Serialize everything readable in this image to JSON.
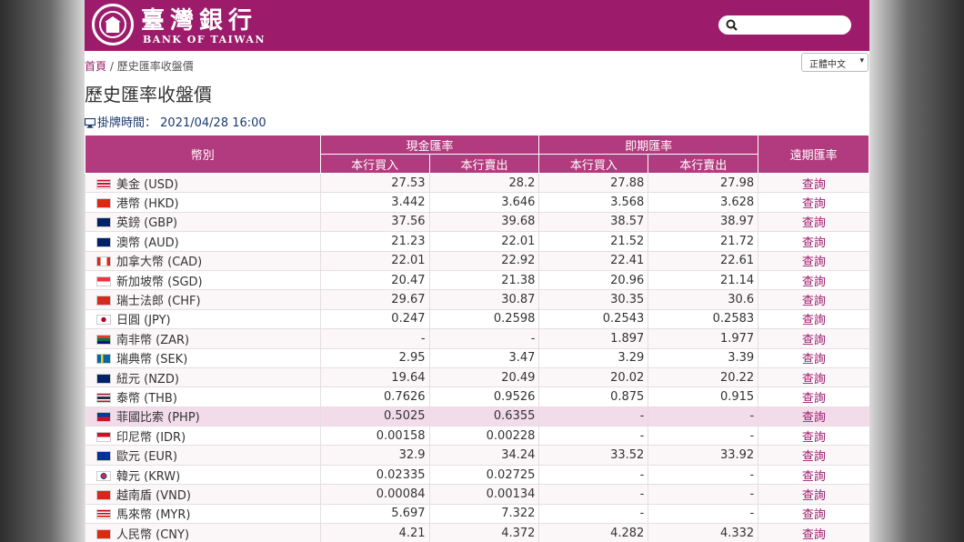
{
  "header": {
    "logo_cn": "臺灣銀行",
    "logo_en": "BANK OF TAIWAN"
  },
  "breadcrumb": {
    "home": "首頁",
    "separator": " / ",
    "current": "歷史匯率收盤價"
  },
  "language": {
    "selected": "正體中文"
  },
  "page_title": "歷史匯率收盤價",
  "quote_time": {
    "label": "掛牌時間：",
    "value": "2021/04/28 16:00"
  },
  "table": {
    "headers": {
      "currency": "幣別",
      "cash": "現金匯率",
      "spot": "即期匯率",
      "forward": "遠期匯率",
      "buy": "本行買入",
      "sell": "本行賣出"
    },
    "rows": [
      {
        "flag": "us",
        "name": "美金 (USD)",
        "cash_buy": "27.53",
        "cash_sell": "28.2",
        "spot_buy": "27.88",
        "spot_sell": "27.98",
        "query": "查詢"
      },
      {
        "flag": "hk",
        "name": "港幣 (HKD)",
        "cash_buy": "3.442",
        "cash_sell": "3.646",
        "spot_buy": "3.568",
        "spot_sell": "3.628",
        "query": "查詢"
      },
      {
        "flag": "gb",
        "name": "英鎊 (GBP)",
        "cash_buy": "37.56",
        "cash_sell": "39.68",
        "spot_buy": "38.57",
        "spot_sell": "38.97",
        "query": "查詢"
      },
      {
        "flag": "au",
        "name": "澳幣 (AUD)",
        "cash_buy": "21.23",
        "cash_sell": "22.01",
        "spot_buy": "21.52",
        "spot_sell": "21.72",
        "query": "查詢"
      },
      {
        "flag": "ca",
        "name": "加拿大幣 (CAD)",
        "cash_buy": "22.01",
        "cash_sell": "22.92",
        "spot_buy": "22.41",
        "spot_sell": "22.61",
        "query": "查詢"
      },
      {
        "flag": "sg",
        "name": "新加坡幣 (SGD)",
        "cash_buy": "20.47",
        "cash_sell": "21.38",
        "spot_buy": "20.96",
        "spot_sell": "21.14",
        "query": "查詢"
      },
      {
        "flag": "ch",
        "name": "瑞士法郎 (CHF)",
        "cash_buy": "29.67",
        "cash_sell": "30.87",
        "spot_buy": "30.35",
        "spot_sell": "30.6",
        "query": "查詢"
      },
      {
        "flag": "jp",
        "name": "日圓 (JPY)",
        "cash_buy": "0.247",
        "cash_sell": "0.2598",
        "spot_buy": "0.2543",
        "spot_sell": "0.2583",
        "query": "查詢"
      },
      {
        "flag": "za",
        "name": "南非幣 (ZAR)",
        "cash_buy": "-",
        "cash_sell": "-",
        "spot_buy": "1.897",
        "spot_sell": "1.977",
        "query": "查詢"
      },
      {
        "flag": "se",
        "name": "瑞典幣 (SEK)",
        "cash_buy": "2.95",
        "cash_sell": "3.47",
        "spot_buy": "3.29",
        "spot_sell": "3.39",
        "query": "查詢"
      },
      {
        "flag": "nz",
        "name": "紐元 (NZD)",
        "cash_buy": "19.64",
        "cash_sell": "20.49",
        "spot_buy": "20.02",
        "spot_sell": "20.22",
        "query": "查詢"
      },
      {
        "flag": "th",
        "name": "泰幣 (THB)",
        "cash_buy": "0.7626",
        "cash_sell": "0.9526",
        "spot_buy": "0.875",
        "spot_sell": "0.915",
        "query": "查詢"
      },
      {
        "flag": "ph",
        "name": "菲國比索 (PHP)",
        "cash_buy": "0.5025",
        "cash_sell": "0.6355",
        "spot_buy": "-",
        "spot_sell": "-",
        "query": "查詢",
        "highlight": true
      },
      {
        "flag": "id",
        "name": "印尼幣 (IDR)",
        "cash_buy": "0.00158",
        "cash_sell": "0.00228",
        "spot_buy": "-",
        "spot_sell": "-",
        "query": "查詢"
      },
      {
        "flag": "eu",
        "name": "歐元 (EUR)",
        "cash_buy": "32.9",
        "cash_sell": "34.24",
        "spot_buy": "33.52",
        "spot_sell": "33.92",
        "query": "查詢"
      },
      {
        "flag": "kr",
        "name": "韓元 (KRW)",
        "cash_buy": "0.02335",
        "cash_sell": "0.02725",
        "spot_buy": "-",
        "spot_sell": "-",
        "query": "查詢"
      },
      {
        "flag": "vn",
        "name": "越南盾 (VND)",
        "cash_buy": "0.00084",
        "cash_sell": "0.00134",
        "spot_buy": "-",
        "spot_sell": "-",
        "query": "查詢"
      },
      {
        "flag": "my",
        "name": "馬來幣 (MYR)",
        "cash_buy": "5.697",
        "cash_sell": "7.322",
        "spot_buy": "-",
        "spot_sell": "-",
        "query": "查詢"
      },
      {
        "flag": "cn",
        "name": "人民幣 (CNY)",
        "cash_buy": "4.21",
        "cash_sell": "4.372",
        "spot_buy": "4.282",
        "spot_sell": "4.332",
        "query": "查詢"
      }
    ]
  },
  "colors": {
    "brand": "#9c1c6b",
    "header_cell": "#b23a7e",
    "highlight_row": "#f3dcea"
  }
}
